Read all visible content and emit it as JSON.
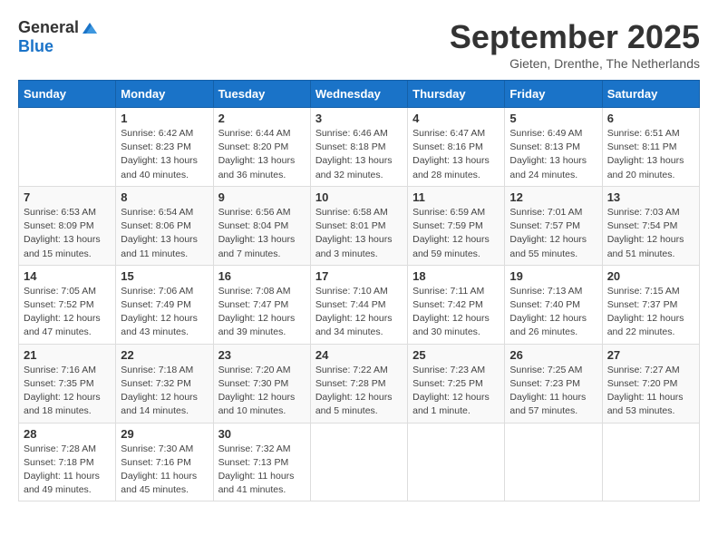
{
  "header": {
    "logo_general": "General",
    "logo_blue": "Blue",
    "month_title": "September 2025",
    "location": "Gieten, Drenthe, The Netherlands"
  },
  "days_of_week": [
    "Sunday",
    "Monday",
    "Tuesday",
    "Wednesday",
    "Thursday",
    "Friday",
    "Saturday"
  ],
  "weeks": [
    [
      {
        "day": "",
        "info": ""
      },
      {
        "day": "1",
        "info": "Sunrise: 6:42 AM\nSunset: 8:23 PM\nDaylight: 13 hours\nand 40 minutes."
      },
      {
        "day": "2",
        "info": "Sunrise: 6:44 AM\nSunset: 8:20 PM\nDaylight: 13 hours\nand 36 minutes."
      },
      {
        "day": "3",
        "info": "Sunrise: 6:46 AM\nSunset: 8:18 PM\nDaylight: 13 hours\nand 32 minutes."
      },
      {
        "day": "4",
        "info": "Sunrise: 6:47 AM\nSunset: 8:16 PM\nDaylight: 13 hours\nand 28 minutes."
      },
      {
        "day": "5",
        "info": "Sunrise: 6:49 AM\nSunset: 8:13 PM\nDaylight: 13 hours\nand 24 minutes."
      },
      {
        "day": "6",
        "info": "Sunrise: 6:51 AM\nSunset: 8:11 PM\nDaylight: 13 hours\nand 20 minutes."
      }
    ],
    [
      {
        "day": "7",
        "info": "Sunrise: 6:53 AM\nSunset: 8:09 PM\nDaylight: 13 hours\nand 15 minutes."
      },
      {
        "day": "8",
        "info": "Sunrise: 6:54 AM\nSunset: 8:06 PM\nDaylight: 13 hours\nand 11 minutes."
      },
      {
        "day": "9",
        "info": "Sunrise: 6:56 AM\nSunset: 8:04 PM\nDaylight: 13 hours\nand 7 minutes."
      },
      {
        "day": "10",
        "info": "Sunrise: 6:58 AM\nSunset: 8:01 PM\nDaylight: 13 hours\nand 3 minutes."
      },
      {
        "day": "11",
        "info": "Sunrise: 6:59 AM\nSunset: 7:59 PM\nDaylight: 12 hours\nand 59 minutes."
      },
      {
        "day": "12",
        "info": "Sunrise: 7:01 AM\nSunset: 7:57 PM\nDaylight: 12 hours\nand 55 minutes."
      },
      {
        "day": "13",
        "info": "Sunrise: 7:03 AM\nSunset: 7:54 PM\nDaylight: 12 hours\nand 51 minutes."
      }
    ],
    [
      {
        "day": "14",
        "info": "Sunrise: 7:05 AM\nSunset: 7:52 PM\nDaylight: 12 hours\nand 47 minutes."
      },
      {
        "day": "15",
        "info": "Sunrise: 7:06 AM\nSunset: 7:49 PM\nDaylight: 12 hours\nand 43 minutes."
      },
      {
        "day": "16",
        "info": "Sunrise: 7:08 AM\nSunset: 7:47 PM\nDaylight: 12 hours\nand 39 minutes."
      },
      {
        "day": "17",
        "info": "Sunrise: 7:10 AM\nSunset: 7:44 PM\nDaylight: 12 hours\nand 34 minutes."
      },
      {
        "day": "18",
        "info": "Sunrise: 7:11 AM\nSunset: 7:42 PM\nDaylight: 12 hours\nand 30 minutes."
      },
      {
        "day": "19",
        "info": "Sunrise: 7:13 AM\nSunset: 7:40 PM\nDaylight: 12 hours\nand 26 minutes."
      },
      {
        "day": "20",
        "info": "Sunrise: 7:15 AM\nSunset: 7:37 PM\nDaylight: 12 hours\nand 22 minutes."
      }
    ],
    [
      {
        "day": "21",
        "info": "Sunrise: 7:16 AM\nSunset: 7:35 PM\nDaylight: 12 hours\nand 18 minutes."
      },
      {
        "day": "22",
        "info": "Sunrise: 7:18 AM\nSunset: 7:32 PM\nDaylight: 12 hours\nand 14 minutes."
      },
      {
        "day": "23",
        "info": "Sunrise: 7:20 AM\nSunset: 7:30 PM\nDaylight: 12 hours\nand 10 minutes."
      },
      {
        "day": "24",
        "info": "Sunrise: 7:22 AM\nSunset: 7:28 PM\nDaylight: 12 hours\nand 5 minutes."
      },
      {
        "day": "25",
        "info": "Sunrise: 7:23 AM\nSunset: 7:25 PM\nDaylight: 12 hours\nand 1 minute."
      },
      {
        "day": "26",
        "info": "Sunrise: 7:25 AM\nSunset: 7:23 PM\nDaylight: 11 hours\nand 57 minutes."
      },
      {
        "day": "27",
        "info": "Sunrise: 7:27 AM\nSunset: 7:20 PM\nDaylight: 11 hours\nand 53 minutes."
      }
    ],
    [
      {
        "day": "28",
        "info": "Sunrise: 7:28 AM\nSunset: 7:18 PM\nDaylight: 11 hours\nand 49 minutes."
      },
      {
        "day": "29",
        "info": "Sunrise: 7:30 AM\nSunset: 7:16 PM\nDaylight: 11 hours\nand 45 minutes."
      },
      {
        "day": "30",
        "info": "Sunrise: 7:32 AM\nSunset: 7:13 PM\nDaylight: 11 hours\nand 41 minutes."
      },
      {
        "day": "",
        "info": ""
      },
      {
        "day": "",
        "info": ""
      },
      {
        "day": "",
        "info": ""
      },
      {
        "day": "",
        "info": ""
      }
    ]
  ]
}
